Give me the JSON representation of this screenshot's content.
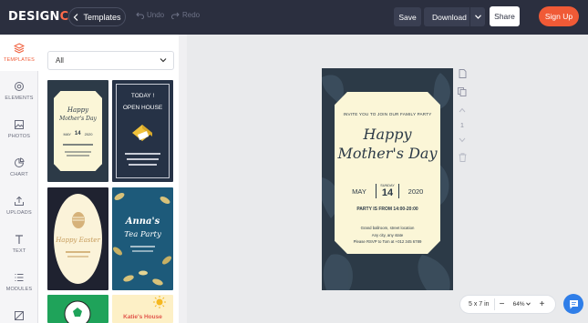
{
  "topbar": {
    "logo_part1": "DESIGN",
    "logo_part2": "CAP",
    "templates_label": "Templates",
    "undo_label": "Undo",
    "redo_label": "Redo",
    "save_label": "Save",
    "download_label": "Download",
    "share_label": "Share",
    "signup_label": "Sign Up"
  },
  "rail": {
    "items": [
      {
        "label": "TEMPLATES",
        "icon": "layers-icon"
      },
      {
        "label": "ELEMENTS",
        "icon": "elements-icon"
      },
      {
        "label": "PHOTOS",
        "icon": "image-icon"
      },
      {
        "label": "CHART",
        "icon": "pie-chart-icon"
      },
      {
        "label": "UPLOADS",
        "icon": "upload-icon"
      },
      {
        "label": "TEXT",
        "icon": "text-icon"
      },
      {
        "label": "MODULES",
        "icon": "list-icon"
      }
    ]
  },
  "panel": {
    "filter_value": "All",
    "thumbs": {
      "t1": {
        "line1": "Happy",
        "line2": "Mother's Day",
        "day": "14",
        "month": "MAY",
        "year": "2020"
      },
      "t2": {
        "line1": "TODAY !",
        "line2": "OPEN HOUSE"
      },
      "t3": {
        "line1": "Happy Easter"
      },
      "t4": {
        "line1": "Anna's",
        "line2": "Tea Party"
      },
      "t6": {
        "line1": "Katie's House"
      }
    }
  },
  "card": {
    "invite": "INVITE YOU TO JOIN OUR FAMILY PARTY",
    "title1": "Happy",
    "title2": "Mother's Day",
    "month": "MAY",
    "weekday": "SUNDAY",
    "day": "14",
    "year": "2020",
    "party": "PARTY IS FROM 14:00-20:00",
    "loc1": "Grand ballroom, street location",
    "loc2": "Any city, any state",
    "loc3": "Please RSVP to Tom at +012 345 6789"
  },
  "side_tools": {
    "page_number": "1"
  },
  "zoombar": {
    "size": "5 x 7 in",
    "zoom": "64%"
  },
  "colors": {
    "topbar": "#2b2f3f",
    "accent": "#f05a36",
    "card_bg": "#2c3a47",
    "card_inner": "#fbf6d7",
    "chat": "#2f7ee8"
  }
}
